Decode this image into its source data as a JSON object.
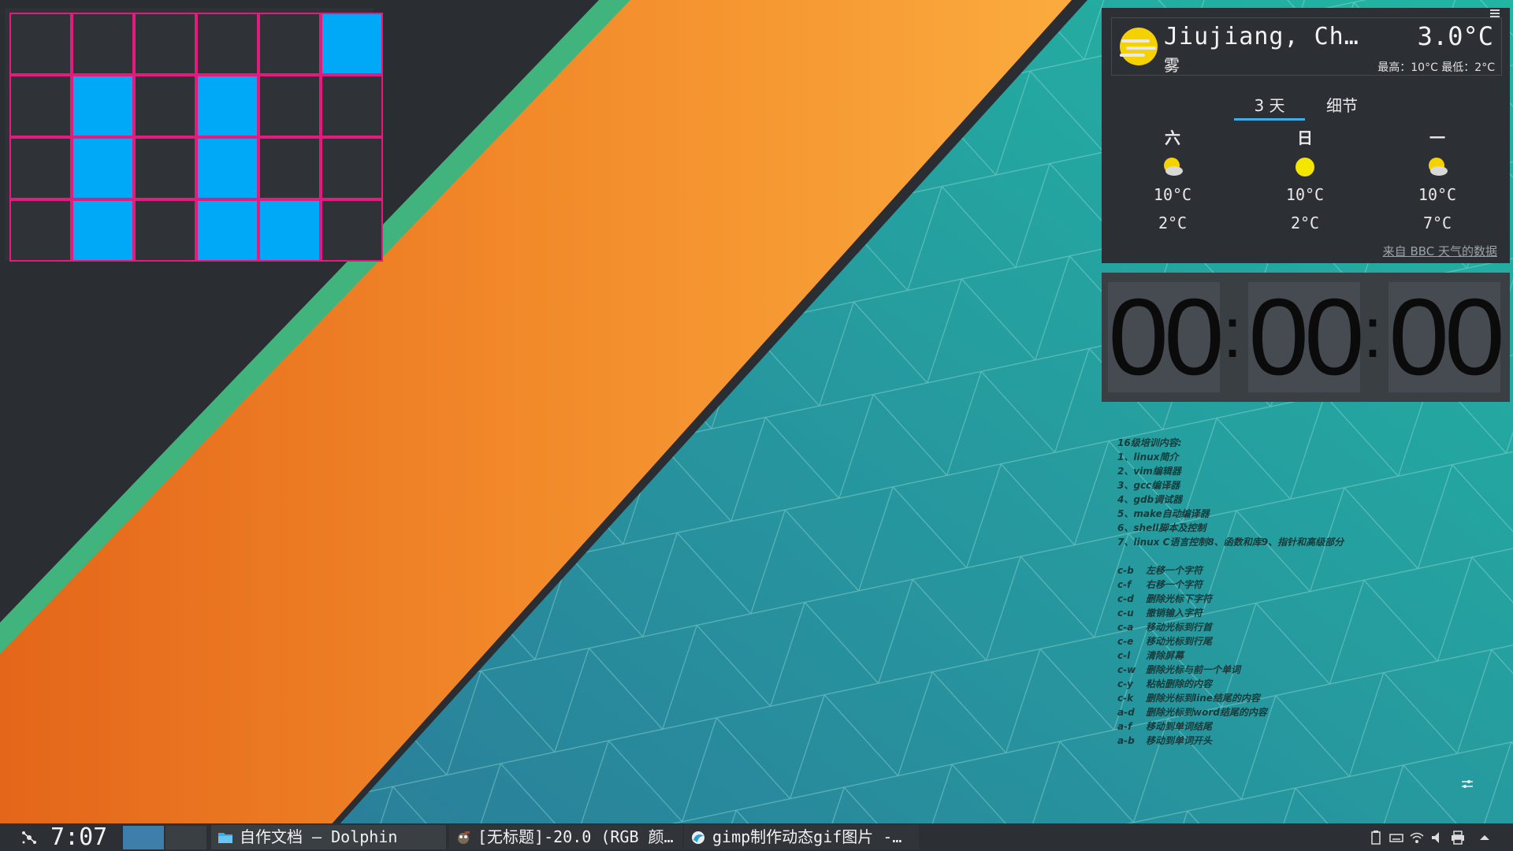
{
  "colors": {
    "accent": "#3daee9",
    "binary_on": "#00a9f7",
    "binary_grid": "#e6197e",
    "wallpaper_orange": "#f08a24",
    "wallpaper_teal": "#23a6a0"
  },
  "binary_clock": {
    "rows": [
      [
        0,
        0,
        0,
        0,
        0,
        1
      ],
      [
        0,
        1,
        0,
        1,
        0,
        0
      ],
      [
        0,
        1,
        0,
        1,
        0,
        0
      ],
      [
        0,
        1,
        0,
        1,
        1,
        0
      ]
    ]
  },
  "weather": {
    "city": "Jiujiang, Ch…",
    "condition": "雾",
    "current_temp": "3.0°C",
    "hi_lo": "最高：10°C 最低：2°C",
    "icon": "fog-sun-icon",
    "tabs": [
      "3 天",
      "细节"
    ],
    "active_tab": "3 天",
    "forecast": [
      {
        "day": "六",
        "icon": "partly-cloudy-icon",
        "high": "10°C",
        "low": "2°C"
      },
      {
        "day": "日",
        "icon": "sun-icon",
        "high": "10°C",
        "low": "2°C"
      },
      {
        "day": "一",
        "icon": "partly-cloudy-icon",
        "high": "10°C",
        "low": "7°C"
      }
    ],
    "source": "来自 BBC 天气的数据"
  },
  "digital_clock": {
    "hours": "00",
    "minutes": "00",
    "seconds": "00",
    "separator": ":"
  },
  "note": {
    "title": "16级培训内容:",
    "items": [
      "1、linux简介",
      "2、vim编辑器",
      "3、gcc编译器",
      "4、gdb调试器",
      "5、make自动编译器",
      "6、shell脚本及控制",
      "7、linux C语言控制8、函数和库9、指针和高级部分"
    ],
    "shortcuts": [
      {
        "key": "c-b",
        "desc": "左移一个字符"
      },
      {
        "key": "c-f",
        "desc": "右移一个字符"
      },
      {
        "key": "c-d",
        "desc": "删除光标下字符"
      },
      {
        "key": "c-u",
        "desc": "撤销输入字符"
      },
      {
        "key": "c-a",
        "desc": "移动光标到行首"
      },
      {
        "key": "c-e",
        "desc": "移动光标到行尾"
      },
      {
        "key": "c-l",
        "desc": "清除屏幕"
      },
      {
        "key": "c-w",
        "desc": "删除光标与前一个单词"
      },
      {
        "key": "c-y",
        "desc": "粘帖删除的内容"
      },
      {
        "key": "c-k",
        "desc": "删除光标到line结尾的内容"
      },
      {
        "key": "a-d",
        "desc": "删除光标到word结尾的内容"
      },
      {
        "key": "a-f",
        "desc": "移动到单词结尾"
      },
      {
        "key": "a-b",
        "desc": "移动到单词开头"
      }
    ]
  },
  "taskbar": {
    "time": "7:07",
    "tasks": [
      {
        "label": "自作文档 — Dolphin",
        "icon": "folder-icon"
      },
      {
        "label": "[无标题]-20.0 (RGB 颜…",
        "icon": "gimp-icon"
      },
      {
        "label": "gimp制作动态gif图片 -…",
        "icon": "browser-icon"
      }
    ],
    "tray_icons": [
      "clipboard-icon",
      "keyboard-icon",
      "wifi-icon",
      "volume-icon",
      "printer-icon",
      "expand-up-icon"
    ]
  }
}
